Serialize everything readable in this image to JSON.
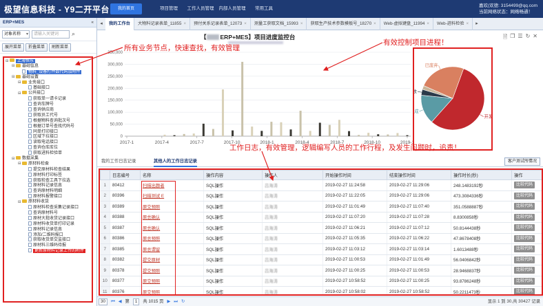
{
  "topbar": {
    "brand": "极望信息科技 - Y9二开平台",
    "home_label": "我的首页",
    "nav": [
      "项目管理",
      "工作人员管理",
      "内部人员管理",
      "常用工具"
    ],
    "user_line1": "嘉欢(欢德: 3154499@qq.com",
    "user_line2": "当前网络状态：网络畅通！"
  },
  "left": {
    "title": "ERP+MES",
    "collapse_icon": "«",
    "search_select": "对象名称",
    "search_placeholder": "请输入关键词",
    "buttons": [
      "展开菜单",
      "折叠菜单",
      "刷新菜单"
    ],
    "tree": [
      {
        "d": 0,
        "t": "上海恒东",
        "k": "sel-blue",
        "ic": "folder",
        "tg": "⊟"
      },
      {
        "d": 1,
        "t": "基础信息",
        "k": "",
        "ic": "folder",
        "tg": "⊟"
      },
      {
        "d": 2,
        "t": "物料_设备打件数代码加附件",
        "k": "sel-blue",
        "ic": "leaf",
        "tg": ""
      },
      {
        "d": 1,
        "t": "基础设置",
        "k": "",
        "ic": "folder",
        "tg": "⊟"
      },
      {
        "d": 2,
        "t": "业务接口",
        "k": "",
        "ic": "folder",
        "tg": "⊟"
      },
      {
        "d": 3,
        "t": "基础接口",
        "k": "",
        "ic": "leaf",
        "tg": ""
      },
      {
        "d": 2,
        "t": "公共接口",
        "k": "",
        "ic": "folder",
        "tg": "⊟"
      },
      {
        "d": 3,
        "t": "获取单一请卡记录",
        "k": "",
        "ic": "leaf",
        "tg": ""
      },
      {
        "d": 3,
        "t": "查询车牌号",
        "k": "",
        "ic": "leaf",
        "tg": ""
      },
      {
        "d": 3,
        "t": "查询供应商",
        "k": "",
        "ic": "leaf",
        "tg": ""
      },
      {
        "d": 3,
        "t": "获取员工代号",
        "k": "",
        "ic": "leaf",
        "tg": ""
      },
      {
        "d": 3,
        "t": "根据物料查询批次号",
        "k": "",
        "ic": "leaf",
        "tg": ""
      },
      {
        "d": 3,
        "t": "根据订单号查找代码号",
        "k": "",
        "ic": "leaf",
        "tg": ""
      },
      {
        "d": 3,
        "t": "同单打印接口",
        "k": "",
        "ic": "leaf",
        "tg": ""
      },
      {
        "d": 3,
        "t": "区域下拉接口",
        "k": "",
        "ic": "leaf",
        "tg": ""
      },
      {
        "d": 3,
        "t": "读取电话接口",
        "k": "",
        "ic": "leaf",
        "tg": ""
      },
      {
        "d": 3,
        "t": "查询仓库库位",
        "k": "",
        "ic": "leaf",
        "tg": ""
      },
      {
        "d": 3,
        "t": "获取进料检验单",
        "k": "",
        "ic": "leaf",
        "tg": ""
      },
      {
        "d": 1,
        "t": "数据采集",
        "k": "",
        "ic": "folder",
        "tg": "⊟"
      },
      {
        "d": 2,
        "t": "原材料检查",
        "k": "",
        "ic": "folder",
        "tg": "⊟"
      },
      {
        "d": 3,
        "t": "提交原材料检查结果",
        "k": "",
        "ic": "leaf",
        "tg": ""
      },
      {
        "d": 3,
        "t": "原材料打印标签",
        "k": "",
        "ic": "leaf",
        "tg": ""
      },
      {
        "d": 3,
        "t": "获取检查工具下拉选",
        "k": "",
        "ic": "leaf",
        "tg": ""
      },
      {
        "d": 3,
        "t": "原材料记录信息",
        "k": "",
        "ic": "leaf",
        "tg": ""
      },
      {
        "d": 3,
        "t": "查询原材料明细",
        "k": "",
        "ic": "leaf",
        "tg": ""
      },
      {
        "d": 3,
        "t": "原材料报警接口",
        "k": "",
        "ic": "leaf",
        "tg": ""
      },
      {
        "d": 2,
        "t": "原材料收货",
        "k": "",
        "ic": "folder",
        "tg": "⊟"
      },
      {
        "d": 3,
        "t": "原材料检查采集记录接口",
        "k": "",
        "ic": "leaf",
        "tg": ""
      },
      {
        "d": 3,
        "t": "查询原材料号",
        "k": "",
        "ic": "leaf",
        "tg": ""
      },
      {
        "d": 3,
        "t": "原材大批收货记录接口",
        "k": "",
        "ic": "leaf",
        "tg": ""
      },
      {
        "d": 3,
        "t": "原材料收货单打印记录",
        "k": "",
        "ic": "leaf",
        "tg": ""
      },
      {
        "d": 3,
        "t": "原材料记录信息",
        "k": "",
        "ic": "leaf",
        "tg": ""
      },
      {
        "d": 3,
        "t": "添加/二维码报口",
        "k": "",
        "ic": "leaf",
        "tg": ""
      },
      {
        "d": 3,
        "t": "获取收货单交监接口",
        "k": "",
        "ic": "leaf",
        "tg": ""
      },
      {
        "d": 3,
        "t": "原材料三维码待报",
        "k": "",
        "ic": "leaf",
        "tg": ""
      },
      {
        "d": 3,
        "t": "更新原材料记录上传的附件",
        "k": "sel-red",
        "ic": "leaf",
        "tg": ""
      }
    ]
  },
  "tabs": [
    {
      "label": "我的工作台",
      "active": true
    },
    {
      "label": "大物料记录表单_11855",
      "active": false
    },
    {
      "label": "预付关系记录表单_12073",
      "active": false
    },
    {
      "label": "测量工获取文档_15993",
      "active": false
    },
    {
      "label": "获取生产技术参数模板号_18270",
      "active": false
    },
    {
      "label": "Web-虚拟键盘_11994",
      "active": false
    },
    {
      "label": "Web-进料检验",
      "active": false
    }
  ],
  "dashboard": {
    "title": "ERP+MES】项目进度监控台",
    "title_prefix": "【",
    "icons": [
      "doc-icon",
      "copy-icon",
      "list-icon",
      "refresh-icon",
      "close-icon"
    ]
  },
  "annotations": {
    "a1": "所有业务节点，快速查找，有效管理",
    "a2": "有效控制项目进程！",
    "a3": "工作日志，有效管理，逻辑编写人员的工作行程，及发生问题时，追责！"
  },
  "chart_data": [
    {
      "type": "bar",
      "title": "",
      "xlabel": "",
      "ylabel": "",
      "ylim": [
        0,
        350000
      ],
      "yticks": [
        "350,000",
        "300,000",
        "250,000",
        "200,000",
        "150,000",
        "100,000",
        "50,000",
        "0"
      ],
      "x_tick_labels": [
        "2017-1",
        "2017-4",
        "2017-7",
        "2017-10",
        "2018-1",
        "2018-4",
        "2018-7",
        "2018-10",
        "2019-1"
      ],
      "bars": [
        {
          "x": "2017-3",
          "v": 6000
        },
        {
          "x": "2017-6",
          "v": 4000
        },
        {
          "x": "2017-9",
          "v": 9000
        },
        {
          "x": "2017-11",
          "v": 11000
        },
        {
          "x": "2018-1",
          "v": 52000
        },
        {
          "x": "2018-1b",
          "v": 30000
        },
        {
          "x": "2018-2",
          "v": 195000
        },
        {
          "x": "2018-2b",
          "v": 24000
        },
        {
          "x": "2018-3",
          "v": 310000
        },
        {
          "x": "2018-3b",
          "v": 40000
        },
        {
          "x": "2018-4",
          "v": 22000
        },
        {
          "x": "2018-5",
          "v": 60000
        },
        {
          "x": "2018-5b",
          "v": 58000
        },
        {
          "x": "2018-6",
          "v": 28000
        },
        {
          "x": "2018-6b",
          "v": 106000
        },
        {
          "x": "2018-7",
          "v": 22000
        },
        {
          "x": "2018-8",
          "v": 56000
        },
        {
          "x": "2018-8b",
          "v": 47000
        },
        {
          "x": "2018-9",
          "v": 68000
        },
        {
          "x": "2018-9b",
          "v": 21000
        },
        {
          "x": "2018-10",
          "v": 5000
        },
        {
          "x": "2018-11",
          "v": 14000
        },
        {
          "x": "2018-11b",
          "v": 8000
        },
        {
          "x": "2018-12",
          "v": 7000
        },
        {
          "x": "2018-12b",
          "v": 13000
        },
        {
          "x": "2019-1",
          "v": 4000
        }
      ],
      "colors": [
        "#d9d1b8",
        "#3c3a34",
        "#c9c2aa"
      ]
    },
    {
      "type": "pie",
      "title": "",
      "slices": [
        {
          "name": "开发中",
          "value": 56,
          "color": "#c0282d"
        },
        {
          "name": "已完成",
          "value": 15,
          "color": "#5a9ba5"
        },
        {
          "name": "待验收",
          "value": 3,
          "color": "#2b3a4a"
        },
        {
          "name": "",
          "value": 2,
          "color": "#c7b59a"
        },
        {
          "name": "已废弃",
          "value": 24,
          "color": "#d98060"
        }
      ]
    }
  ],
  "subtabs": {
    "t1": "我的工作日志记录",
    "t2": "其他人的工作日志记录",
    "cust": "客户测试所情况"
  },
  "grid": {
    "columns": [
      "",
      "日志编号",
      "名称",
      "操作内容",
      "操作人",
      "开始操作时间",
      "结束操作时间",
      "操作时长(秒)",
      "操作"
    ],
    "rows": [
      {
        "n": "1",
        "id": "80412",
        "name": "扫描出题者",
        "content": "SQL操作",
        "op": "吕海涛",
        "start": "2019-02-27 11:24:58",
        "end": "2019-02-27 11:29:06",
        "dur": "248.1483192秒",
        "btn": "比较代码"
      },
      {
        "n": "2",
        "id": "80396",
        "name": "扫描测试 E",
        "content": "SQL操作",
        "op": "吕海涛",
        "start": "2019-02-27 11:22:05",
        "end": "2019-02-27 11:29:06",
        "dur": "473.3084336秒",
        "btn": "比较代码"
      },
      {
        "n": "3",
        "id": "80389",
        "name": "原交预照",
        "content": "SQL操作",
        "op": "吕海涛",
        "start": "2019-02-27 11:01:49",
        "end": "2019-02-27 11:07:40",
        "dur": "351.0588887秒",
        "btn": "比较代码"
      },
      {
        "n": "4",
        "id": "80388",
        "name": "原总确认",
        "content": "SQL操作",
        "op": "吕海涛",
        "start": "2019-02-27 11:07:20",
        "end": "2019-02-27 11:07:28",
        "dur": "8.8300858秒",
        "btn": "比较代码"
      },
      {
        "n": "5",
        "id": "80387",
        "name": "原总确认",
        "content": "SQL操作",
        "op": "吕海涛",
        "start": "2019-02-27 11:06:21",
        "end": "2019-02-27 11:07:12",
        "dur": "50.8144438秒",
        "btn": "比较代码"
      },
      {
        "n": "6",
        "id": "80386",
        "name": "原总预照",
        "content": "SQL操作",
        "op": "吕海涛",
        "start": "2019-02-27 11:05:35",
        "end": "2019-02-27 11:06:22",
        "dur": "47.8678408秒",
        "btn": "比较代码"
      },
      {
        "n": "7",
        "id": "80385",
        "name": "原总谓留",
        "content": "SQL操作",
        "op": "吕海涛",
        "start": "2019-02-27 11:03:12",
        "end": "2019-02-27 11:03:14",
        "dur": "1.6013488秒",
        "btn": "比较代码"
      },
      {
        "n": "8",
        "id": "80382",
        "name": "提交原材",
        "content": "SQL操作",
        "op": "吕海涛",
        "start": "2019-02-27 11:00:53",
        "end": "2019-02-27 11:01:49",
        "dur": "56.0406842秒",
        "btn": "比较代码"
      },
      {
        "n": "9",
        "id": "80378",
        "name": "提交预照",
        "content": "SQL操作",
        "op": "吕海涛",
        "start": "2019-02-27 11:00:25",
        "end": "2019-02-27 11:00:53",
        "dur": "28.9468837秒",
        "btn": "比较代码"
      },
      {
        "n": "10",
        "id": "80377",
        "name": "原交预照",
        "content": "SQL操作",
        "op": "吕海涛",
        "start": "2019-02-27 10:58:52",
        "end": "2019-02-27 11:00:25",
        "dur": "93.8786248秒",
        "btn": "比较代码"
      },
      {
        "n": "11",
        "id": "80376",
        "name": "原交预照",
        "content": "SQL操作",
        "op": "吕海涛",
        "start": "2019-02-27 10:58:02",
        "end": "2019-02-27 10:58:52",
        "dur": "50.2211473秒",
        "btn": "比较代码"
      }
    ]
  },
  "pager": {
    "page_size": "30",
    "page_prefix": "第",
    "page": "1",
    "page_total": "共 1015 页",
    "summary": "显示 1 到 30,共 30427 记录"
  }
}
